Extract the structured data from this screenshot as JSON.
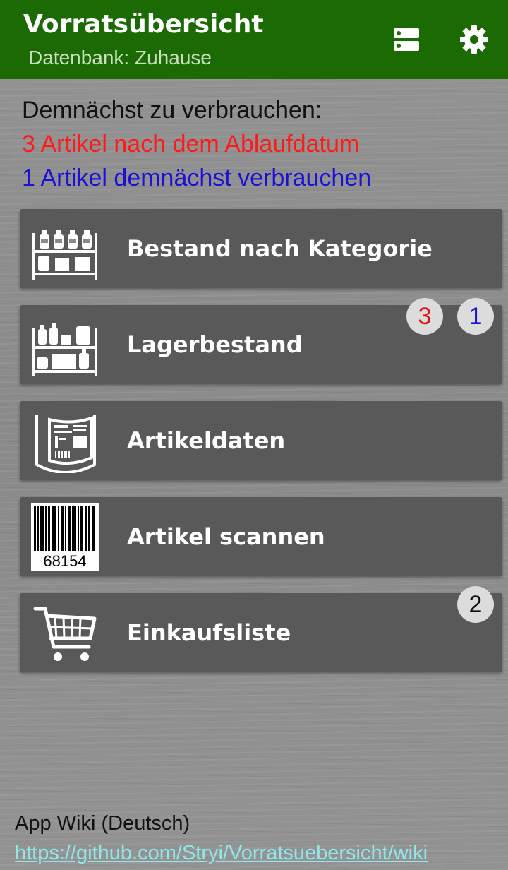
{
  "app_bar": {
    "title": "Vorratsübersicht",
    "subtitle": "Datenbank: Zuhause",
    "icons": [
      "database-icon",
      "settings-gear-icon"
    ],
    "color": "#1b6a03"
  },
  "summary": {
    "heading": "Demnächst zu verbrauchen:",
    "expired": "3 Artikel nach dem Ablaufdatum",
    "soon": "1 Artikel demnächst verbrauchen",
    "expired_color": "#ff1a1a",
    "soon_color": "#1a10d8"
  },
  "menu": [
    {
      "label": "Bestand nach Kategorie",
      "icon": "shelf-bottles-icon"
    },
    {
      "label": "Lagerbestand",
      "icon": "shelf-storage-icon",
      "badges": [
        "3",
        "1"
      ]
    },
    {
      "label": "Artikeldaten",
      "icon": "product-label-icon"
    },
    {
      "label": "Artikel scannen",
      "icon": "barcode-icon",
      "barcode_number": "68154"
    },
    {
      "label": "Einkaufsliste",
      "icon": "shopping-cart-icon",
      "badges": [
        "2"
      ]
    }
  ],
  "footer": {
    "wiki_title": "App Wiki (Deutsch)",
    "wiki_link": "https://github.com/Stryi/Vorratsuebersicht/wiki"
  }
}
